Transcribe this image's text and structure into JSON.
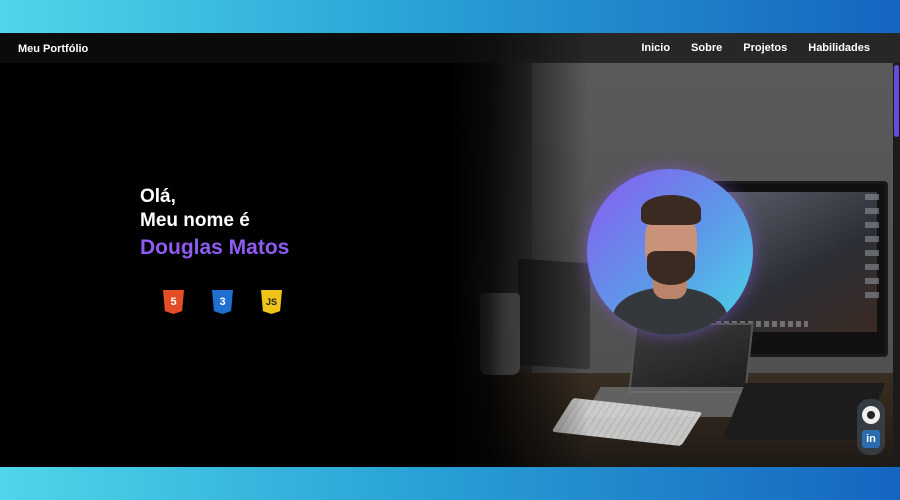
{
  "navbar": {
    "brand": "Meu Portfólio",
    "links": [
      "Inicio",
      "Sobre",
      "Projetos",
      "Habilidades"
    ]
  },
  "hero": {
    "greeting": "Olá,",
    "intro": "Meu nome é",
    "name": "Douglas Matos"
  },
  "tech_icons": [
    {
      "icon": "html5-icon",
      "glyph": "5"
    },
    {
      "icon": "css3-icon",
      "glyph": "3"
    },
    {
      "icon": "javascript-icon",
      "glyph": "JS"
    }
  ],
  "social": {
    "github_icon": "github-icon",
    "linkedin_icon": "linkedin-icon",
    "linkedin_glyph": "in"
  },
  "colors": {
    "name_accent": "#8e5cf0",
    "background": "#000000",
    "page_gradient_start": "#4fd6ea",
    "page_gradient_end": "#1565c0"
  }
}
